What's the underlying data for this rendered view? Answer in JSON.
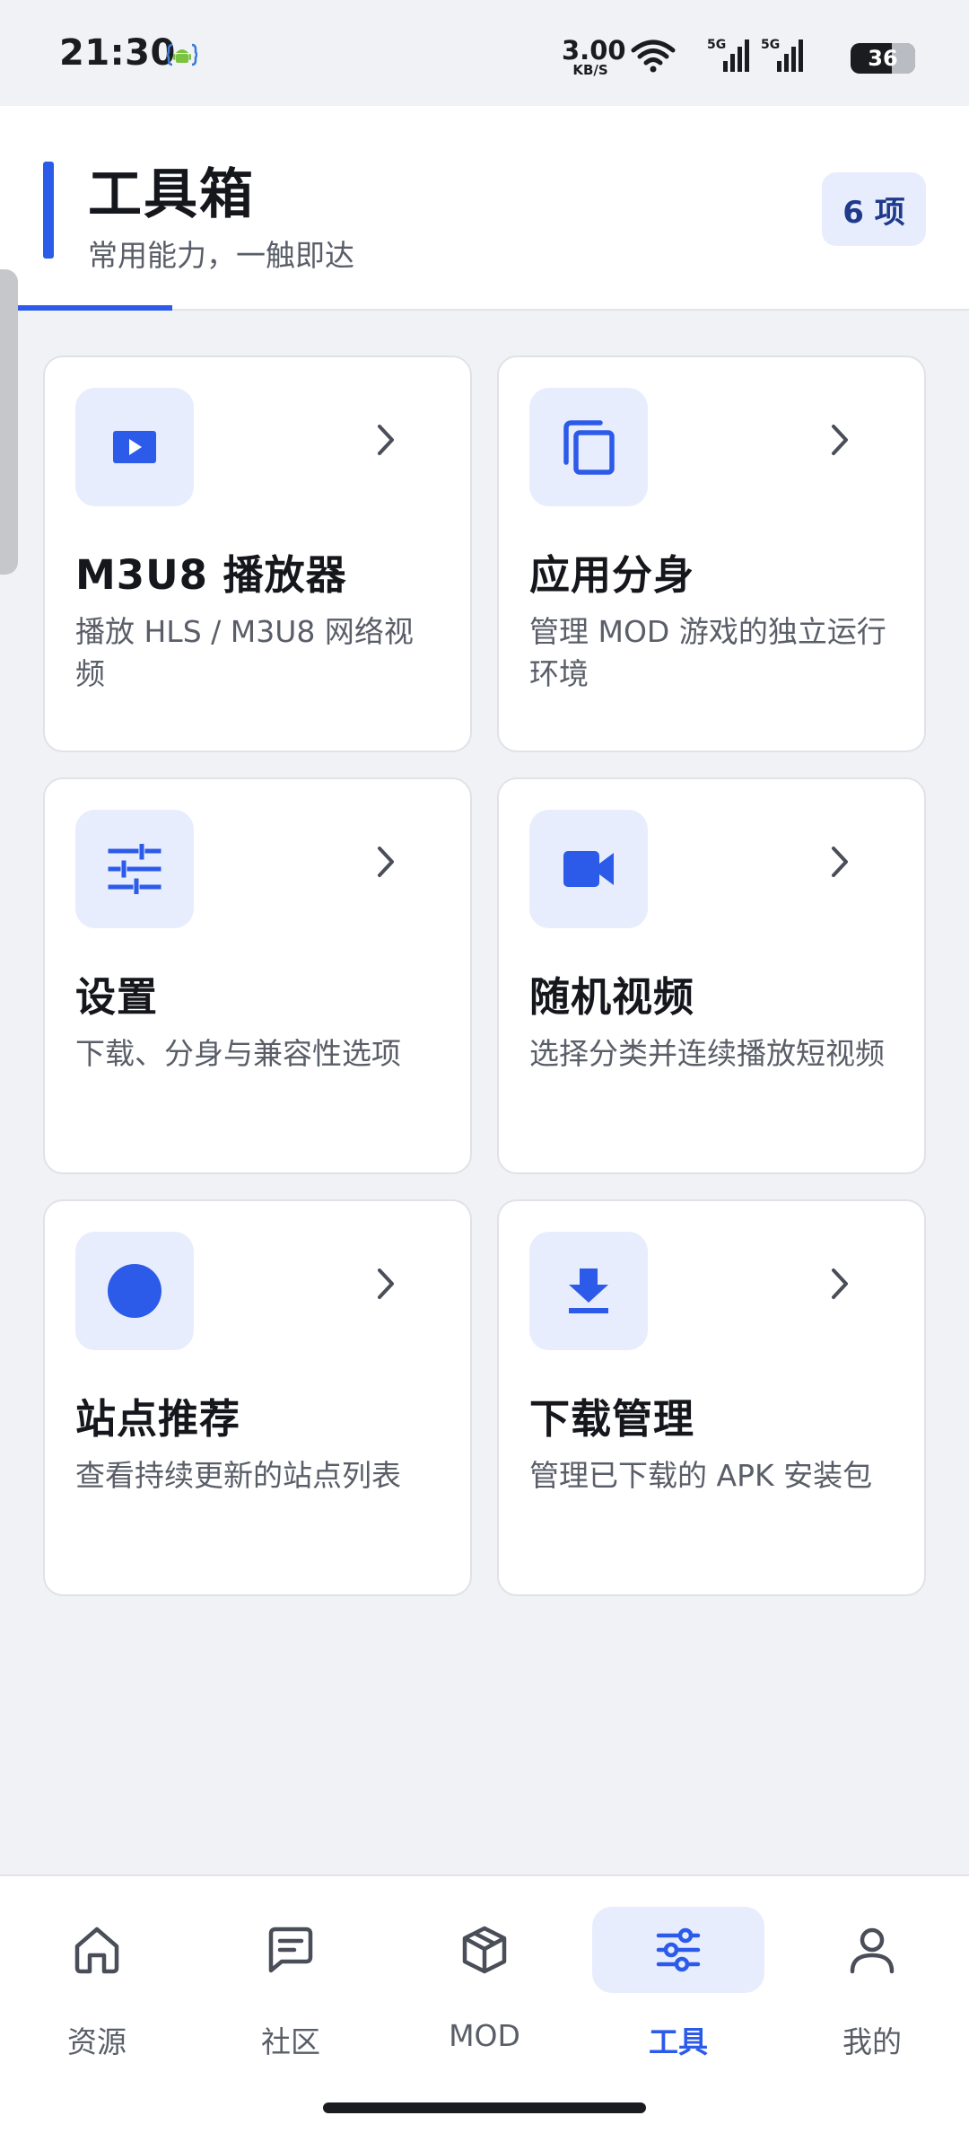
{
  "status_bar": {
    "time": "21:30",
    "app_icon": "android-dev-icon",
    "net_speed_value": "3.00",
    "net_speed_unit": "KB/S",
    "signal_1_label": "5G",
    "signal_2_label": "5G",
    "battery": "36",
    "battery_level": 0.36
  },
  "header": {
    "title": "工具箱",
    "subtitle": "常用能力，一触即达",
    "count_badge": "6 项"
  },
  "tools": [
    {
      "id": "m3u8",
      "icon": "play-video-icon",
      "title": "M3U8 播放器",
      "description": "播放 HLS / M3U8 网络视频"
    },
    {
      "id": "clone",
      "icon": "copy-icon",
      "title": "应用分身",
      "description": "管理 MOD 游戏的独立运行环境"
    },
    {
      "id": "settings",
      "icon": "sliders-icon",
      "title": "设置",
      "description": "下载、分身与兼容性选项"
    },
    {
      "id": "random-video",
      "icon": "video-camera-icon",
      "title": "随机视频",
      "description": "选择分类并连续播放短视频"
    },
    {
      "id": "sites",
      "icon": "circle-icon",
      "title": "站点推荐",
      "description": "查看持续更新的站点列表"
    },
    {
      "id": "downloads",
      "icon": "download-icon",
      "title": "下载管理",
      "description": "管理已下载的 APK 安装包"
    }
  ],
  "bottom_nav": [
    {
      "id": "resources",
      "icon": "home-icon",
      "label": "资源",
      "active": false
    },
    {
      "id": "community",
      "icon": "message-icon",
      "label": "社区",
      "active": false
    },
    {
      "id": "mod",
      "icon": "package-icon",
      "label": "MOD",
      "active": false
    },
    {
      "id": "tools",
      "icon": "sliders-icon",
      "label": "工具",
      "active": true
    },
    {
      "id": "me",
      "icon": "user-icon",
      "label": "我的",
      "active": false
    }
  ],
  "colors": {
    "accent": "#2c5bea",
    "accent_soft": "#e8edfd",
    "badge_text": "#1f3a8a",
    "background": "#f1f2f6"
  }
}
